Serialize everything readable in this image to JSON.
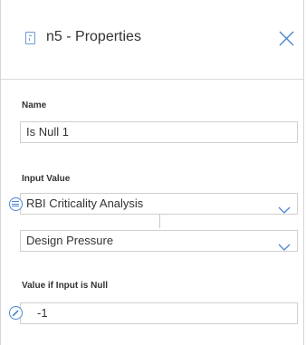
{
  "header": {
    "title": "n5 - Properties",
    "document_icon": "document-icon",
    "close_icon": "close-icon"
  },
  "fields": {
    "name": {
      "label": "Name",
      "value": "Is Null 1"
    },
    "input_value": {
      "label": "Input Value",
      "source_icon": "database-icon",
      "source_select": "RBI Criticality Analysis",
      "field_select": "Design Pressure",
      "dropdown_icon": "chevron-down-icon"
    },
    "value_if_null": {
      "label": "Value if Input is Null",
      "icon": "pencil-icon",
      "value": "-1"
    }
  },
  "colors": {
    "accent": "#4a86cf",
    "border": "#cfcfcf",
    "text": "#333333"
  }
}
